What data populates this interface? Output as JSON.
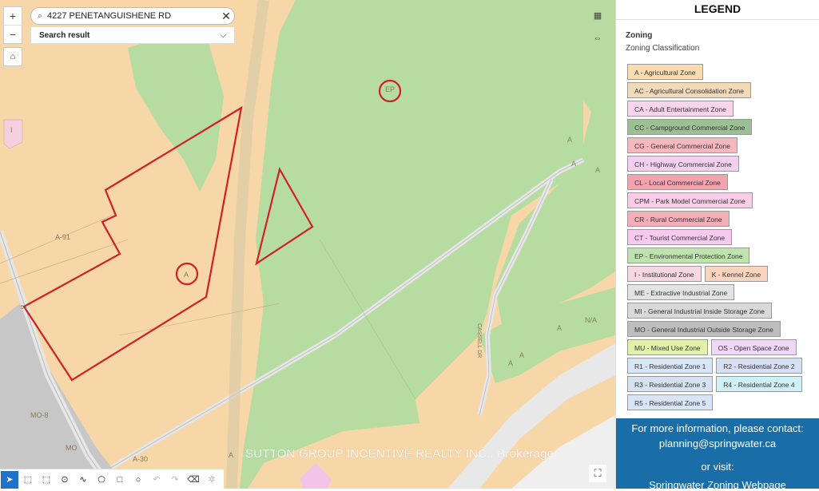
{
  "search": {
    "value": "4227 PENETANGUISHENE RD",
    "result_label": "Search result"
  },
  "map": {
    "zoom_in": "+",
    "zoom_out": "−",
    "labels": {
      "ep": "EP",
      "a_center": "A",
      "i_left": "I",
      "a91": "A-91",
      "a_right1": "A",
      "a_right2": "A",
      "a_right3": "A",
      "a_road1": "A",
      "a_road2": "A",
      "a_road3": "A",
      "na": "N/A",
      "mo8": "MO-8",
      "mo": "MO",
      "a30": "A-30",
      "a_bottom": "A",
      "road_93": "93",
      "cassell": "CASSELL DR"
    },
    "watermark": "SUTTON GROUP INCENTIVE REALTY INC., Brokerage"
  },
  "legend": {
    "title": "LEGEND",
    "heading": "Zoning",
    "subheading": "Zoning Classification",
    "rows": [
      [
        {
          "label": "A - Agricultural Zone",
          "color": "#fbdcb2"
        }
      ],
      [
        {
          "label": "AC - Agricultural Consolidation Zone",
          "color": "#f2d9b8"
        }
      ],
      [
        {
          "label": "CA - Adult Entertainment Zone",
          "color": "#f9d4ea"
        }
      ],
      [
        {
          "label": "CC - Campground Commercial Zone",
          "color": "#9dbf94"
        }
      ],
      [
        {
          "label": "CG - General Commercial Zone",
          "color": "#f7b7bf"
        }
      ],
      [
        {
          "label": "CH - Highway Commercial Zone",
          "color": "#f4d0f0"
        }
      ],
      [
        {
          "label": "CL - Local Commercial Zone",
          "color": "#f2a3ad"
        }
      ],
      [
        {
          "label": "CPM - Park Model Commercial Zone",
          "color": "#f9cde7"
        }
      ],
      [
        {
          "label": "CR - Rural Commercial Zone",
          "color": "#f3aeb8"
        }
      ],
      [
        {
          "label": "CT - Tourist Commercial Zone",
          "color": "#f7c9ef"
        }
      ],
      [
        {
          "label": "EP - Environmental Protection Zone",
          "color": "#bfe3ad"
        }
      ],
      [
        {
          "label": "I - Institutional Zone",
          "color": "#f8d6e2"
        },
        {
          "label": "K - Kennel Zone",
          "color": "#fbd4c0"
        }
      ],
      [
        {
          "label": "ME - Extractive Industrial Zone",
          "color": "#e3e3e3"
        }
      ],
      [
        {
          "label": "MI - General Industrial Inside Storage Zone",
          "color": "#d9d9d9"
        }
      ],
      [
        {
          "label": "MO - General Industrial Outside Storage Zone",
          "color": "#bdbdbd"
        }
      ],
      [
        {
          "label": "MU - Mixed Use Zone",
          "color": "#e3f2a8"
        },
        {
          "label": "OS - Open Space Zone",
          "color": "#f0d6f7"
        }
      ],
      [
        {
          "label": "R1 - Residential Zone 1",
          "color": "#d6e6f7"
        },
        {
          "label": "R2 - Residential Zone 2",
          "color": "#d6e0f5"
        }
      ],
      [
        {
          "label": "R3 - Residential Zone 3",
          "color": "#d4e2f2"
        },
        {
          "label": "R4 - Residential Zone 4",
          "color": "#d0f0f8"
        }
      ],
      [
        {
          "label": "R5 - Residential Zone 5",
          "color": "#d9e4f7"
        }
      ]
    ]
  },
  "info": {
    "line1": "For more information, please contact:",
    "email": "planning@springwater.ca",
    "line3": "or visit:",
    "link": "Springwater Zoning Webpage"
  },
  "toolbar": {
    "icons": [
      "pointer-icon",
      "select-rectangle-icon",
      "select-lasso-icon",
      "point-icon",
      "polyline-icon",
      "polygon-icon",
      "rectangle-icon",
      "circle-icon",
      "undo-icon",
      "redo-icon",
      "eraser-icon",
      "clear-icon"
    ]
  }
}
